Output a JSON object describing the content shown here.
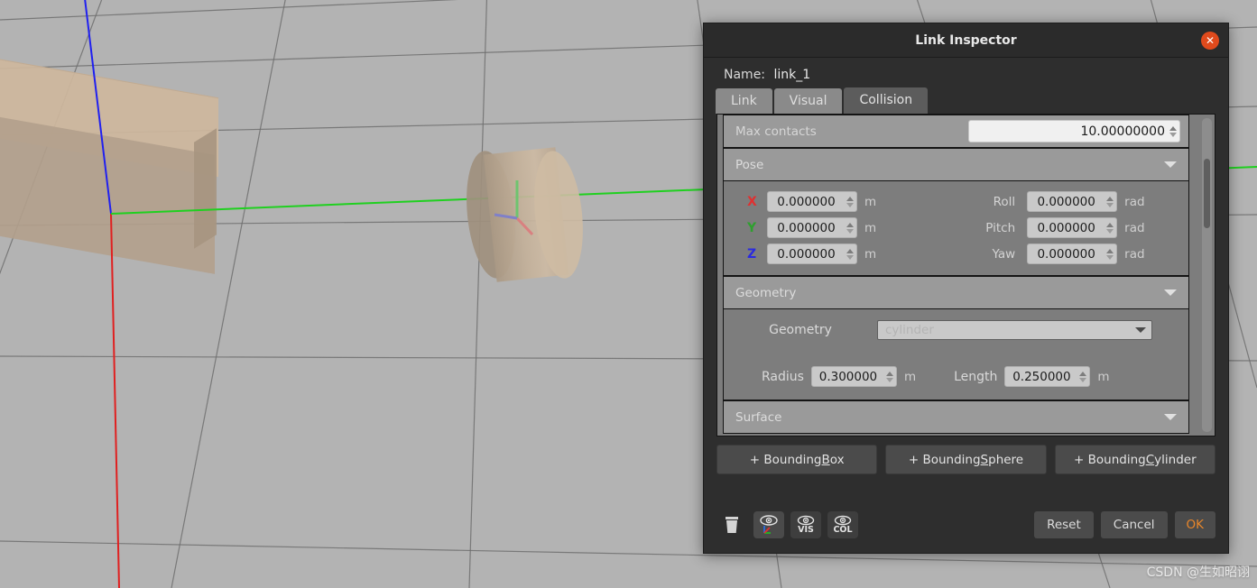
{
  "viewport": {
    "name": "gazebo-3d-viewport",
    "background_color": "#b3b3b3",
    "grid_color": "#6e6e6e",
    "objects": [
      {
        "name": "box-shape",
        "color": "#cdb79d"
      },
      {
        "name": "cylinder-shape",
        "color": "#c5b099"
      }
    ],
    "axes": {
      "x_color": "#e02020",
      "y_color": "#1fd01f",
      "z_color": "#2020f0"
    },
    "watermark": "CSDN @生如昭诩"
  },
  "dialog": {
    "title": "Link Inspector",
    "close_icon": "close-icon",
    "name_label": "Name:",
    "name_value": "link_1",
    "tabs": [
      {
        "label": "Link",
        "active": false
      },
      {
        "label": "Visual",
        "active": false
      },
      {
        "label": "Collision",
        "active": true
      }
    ],
    "max_contacts": {
      "label": "Max contacts",
      "value": "10.00000000"
    },
    "pose": {
      "header": "Pose",
      "rows": [
        {
          "axis": "X",
          "value": "0.000000",
          "unit": "m",
          "rot_label": "Roll",
          "rot_value": "0.000000",
          "rot_unit": "rad"
        },
        {
          "axis": "Y",
          "value": "0.000000",
          "unit": "m",
          "rot_label": "Pitch",
          "rot_value": "0.000000",
          "rot_unit": "rad"
        },
        {
          "axis": "Z",
          "value": "0.000000",
          "unit": "m",
          "rot_label": "Yaw",
          "rot_value": "0.000000",
          "rot_unit": "rad"
        }
      ]
    },
    "geometry": {
      "header": "Geometry",
      "select_label": "Geometry",
      "selected": "cylinder",
      "radius_label": "Radius",
      "radius_value": "0.300000",
      "radius_unit": "m",
      "length_label": "Length",
      "length_value": "0.250000",
      "length_unit": "m"
    },
    "surface": {
      "header": "Surface"
    },
    "bounding_buttons": [
      {
        "pre": "+ Bounding ",
        "accel": "B",
        "post": "ox"
      },
      {
        "pre": "+ Bounding ",
        "accel": "S",
        "post": "phere"
      },
      {
        "pre": "+ Bounding ",
        "accel": "C",
        "post": "ylinder"
      }
    ],
    "footer": {
      "tools": [
        {
          "name": "delete-icon",
          "label": ""
        },
        {
          "name": "show-axes-icon",
          "label": ""
        },
        {
          "name": "show-visual-icon",
          "label": "VIS"
        },
        {
          "name": "show-collision-icon",
          "label": "COL"
        }
      ],
      "reset_label": "Reset",
      "cancel_label": "Cancel",
      "ok_label": "OK",
      "ok_color": "#e8862a"
    }
  }
}
